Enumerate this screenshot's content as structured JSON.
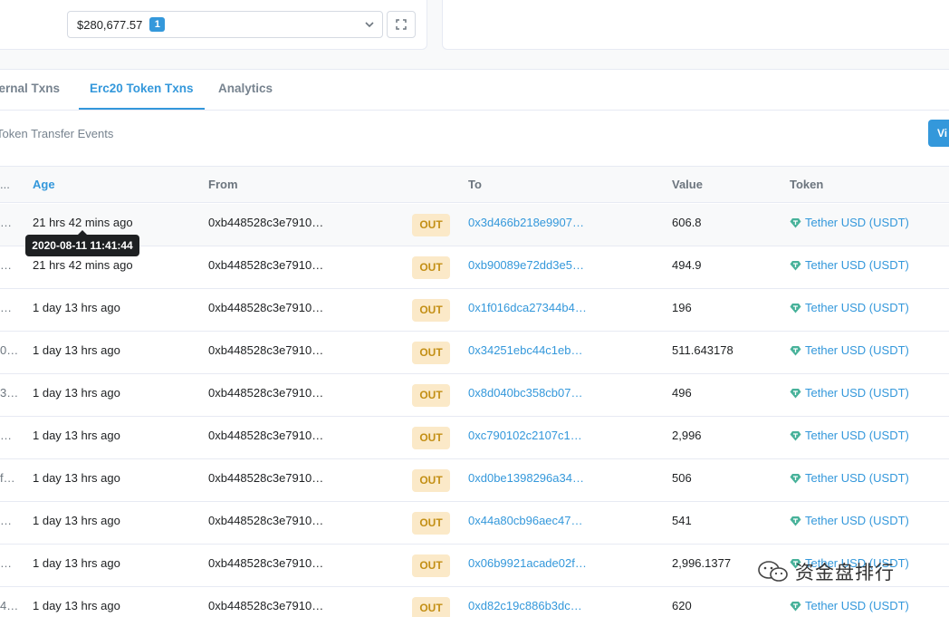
{
  "balance": {
    "value": "$280,677.57",
    "badge": "1"
  },
  "tabs": [
    {
      "label": "ternal Txns"
    },
    {
      "label": "Erc20 Token Txns"
    },
    {
      "label": "Analytics"
    }
  ],
  "subheader": {
    "text": "Token Transfer Events",
    "button_label": "Vi"
  },
  "table": {
    "lead_header": "...",
    "headers": {
      "age": "Age",
      "from": "From",
      "to": "To",
      "value": "Value",
      "token": "Token"
    },
    "rows": [
      {
        "lead": "…",
        "age": "21 hrs 42 mins ago",
        "from": "0xb448528c3e7910…",
        "dir": "OUT",
        "to": "0x3d466b218e9907…",
        "value": "606.8",
        "token": "Tether USD (USDT)"
      },
      {
        "lead": "…",
        "age": "21 hrs 42 mins ago",
        "from": "0xb448528c3e7910…",
        "dir": "OUT",
        "to": "0xb90089e72dd3e5…",
        "value": "494.9",
        "token": "Tether USD (USDT)"
      },
      {
        "lead": "…",
        "age": "1 day 13 hrs ago",
        "from": "0xb448528c3e7910…",
        "dir": "OUT",
        "to": "0x1f016dca27344b4…",
        "value": "196",
        "token": "Tether USD (USDT)"
      },
      {
        "lead": "0…",
        "age": "1 day 13 hrs ago",
        "from": "0xb448528c3e7910…",
        "dir": "OUT",
        "to": "0x34251ebc44c1eb…",
        "value": "511.643178",
        "token": "Tether USD (USDT)"
      },
      {
        "lead": "3…",
        "age": "1 day 13 hrs ago",
        "from": "0xb448528c3e7910…",
        "dir": "OUT",
        "to": "0x8d040bc358cb07…",
        "value": "496",
        "token": "Tether USD (USDT)"
      },
      {
        "lead": "…",
        "age": "1 day 13 hrs ago",
        "from": "0xb448528c3e7910…",
        "dir": "OUT",
        "to": "0xc790102c2107c1…",
        "value": "2,996",
        "token": "Tether USD (USDT)"
      },
      {
        "lead": "f…",
        "age": "1 day 13 hrs ago",
        "from": "0xb448528c3e7910…",
        "dir": "OUT",
        "to": "0xd0be1398296a34…",
        "value": "506",
        "token": "Tether USD (USDT)"
      },
      {
        "lead": "…",
        "age": "1 day 13 hrs ago",
        "from": "0xb448528c3e7910…",
        "dir": "OUT",
        "to": "0x44a80cb96aec47…",
        "value": "541",
        "token": "Tether USD (USDT)"
      },
      {
        "lead": "…",
        "age": "1 day 13 hrs ago",
        "from": "0xb448528c3e7910…",
        "dir": "OUT",
        "to": "0x06b9921acade02f…",
        "value": "2,996.1377",
        "token": "Tether USD (USDT)"
      },
      {
        "lead": "4…",
        "age": "1 day 13 hrs ago",
        "from": "0xb448528c3e7910…",
        "dir": "OUT",
        "to": "0xd82c19c886b3dc…",
        "value": "620",
        "token": "Tether USD (USDT)"
      }
    ]
  },
  "tooltip": {
    "text": "2020-08-11 11:41:44"
  },
  "watermark": {
    "text": "资金盘排行"
  },
  "colors": {
    "accent": "#3498db",
    "out_bg": "#fbe9c8",
    "out_text": "#c38f15",
    "token_icon": "#48b29a"
  },
  "icons": {
    "caret": "chevron-down-icon",
    "expand": "expand-icon",
    "token": "tether-icon",
    "watermark": "wechat-icon"
  }
}
